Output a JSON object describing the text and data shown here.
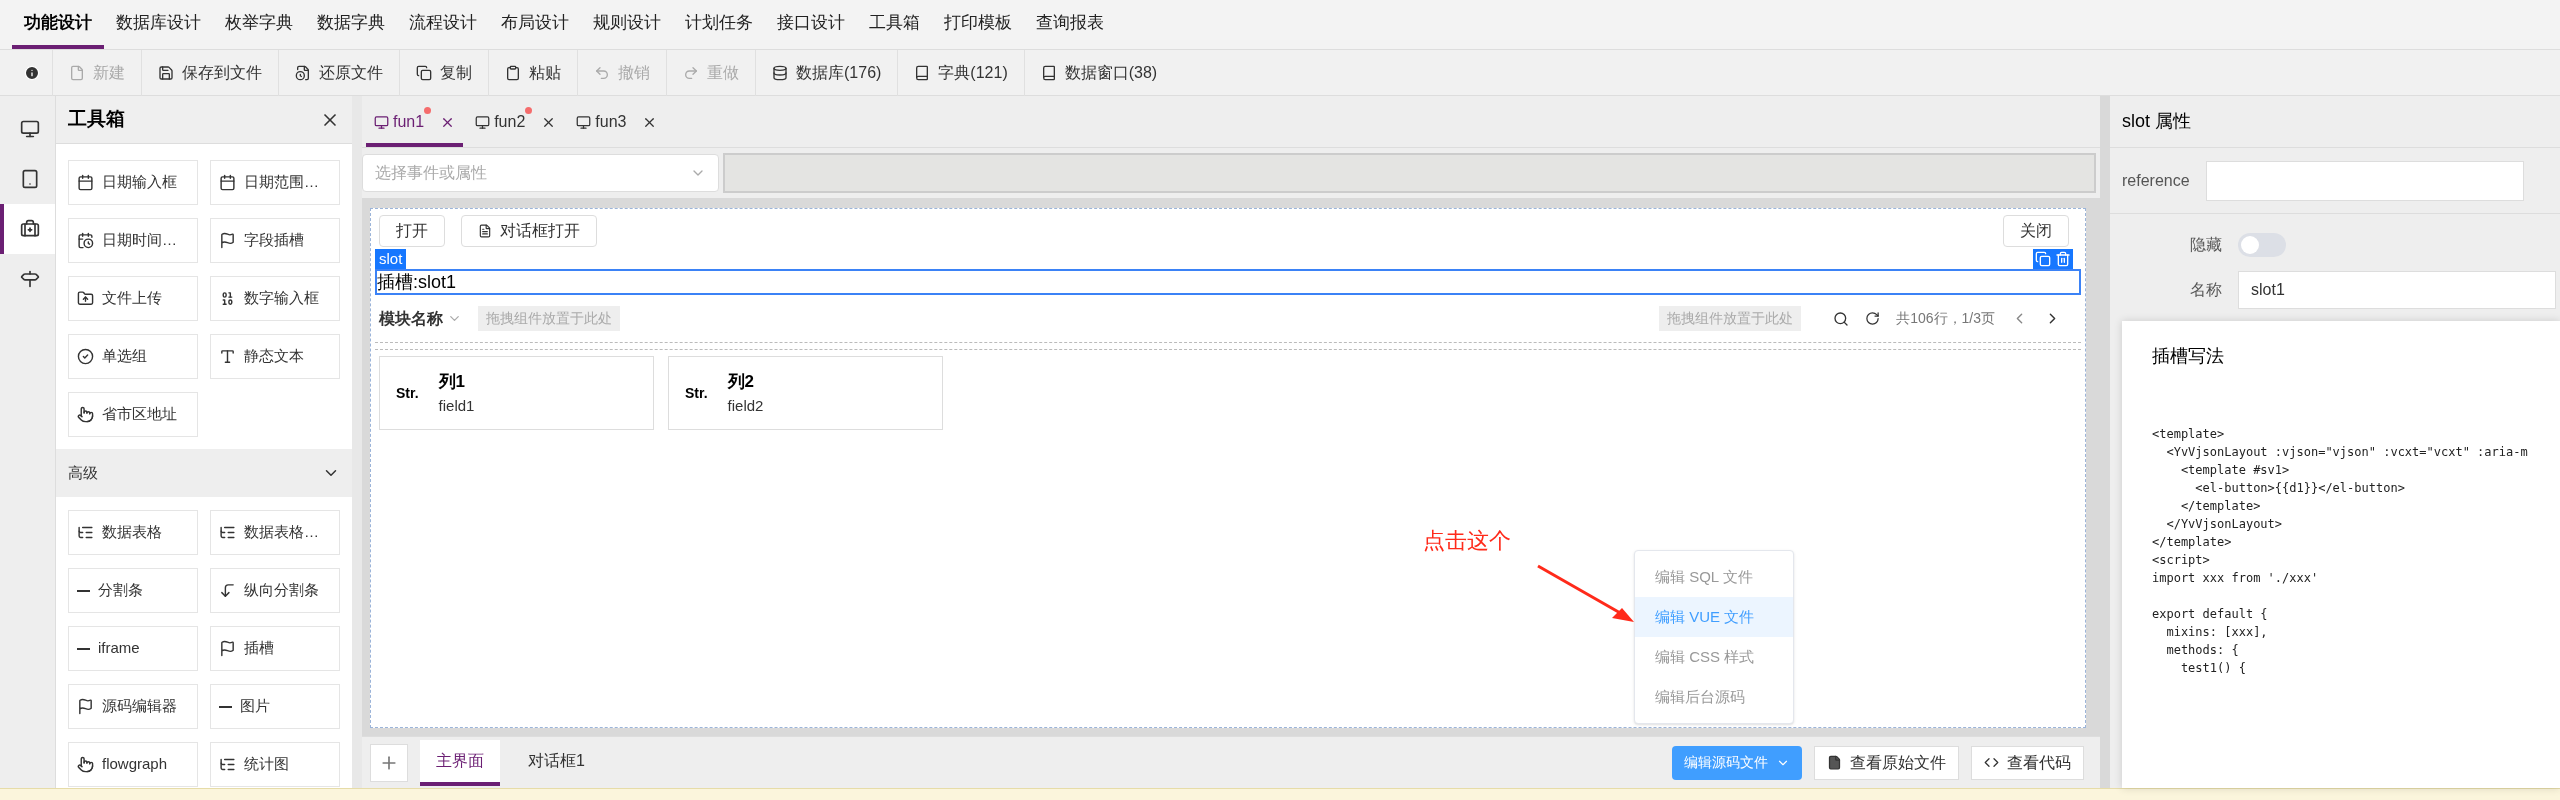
{
  "menu": [
    {
      "label": "功能设计",
      "selected": true
    },
    {
      "label": "数据库设计",
      "selected": false
    },
    {
      "label": "枚举字典",
      "selected": false
    },
    {
      "label": "数据字典",
      "selected": false
    },
    {
      "label": "流程设计",
      "selected": false
    },
    {
      "label": "布局设计",
      "selected": false
    },
    {
      "label": "规则设计",
      "selected": false
    },
    {
      "label": "计划任务",
      "selected": false
    },
    {
      "label": "接口设计",
      "selected": false
    },
    {
      "label": "工具箱",
      "selected": false
    },
    {
      "label": "打印模板",
      "selected": false
    },
    {
      "label": "查询报表",
      "selected": false
    }
  ],
  "toolbar": [
    {
      "kind": "new",
      "label": "新建",
      "disabled": true
    },
    {
      "kind": "save",
      "label": "保存到文件",
      "disabled": false
    },
    {
      "kind": "restore",
      "label": "还原文件",
      "disabled": false
    },
    {
      "kind": "copy",
      "label": "复制",
      "disabled": false
    },
    {
      "kind": "paste",
      "label": "粘贴",
      "disabled": false
    },
    {
      "kind": "undo",
      "label": "撤销",
      "disabled": true
    },
    {
      "kind": "redo",
      "label": "重做",
      "disabled": true
    },
    {
      "kind": "database",
      "label": "数据库(176)",
      "disabled": false
    },
    {
      "kind": "book",
      "label": "字典(121)",
      "disabled": false
    },
    {
      "kind": "book",
      "label": "数据窗口(38)",
      "disabled": false
    }
  ],
  "rail": [
    {
      "kind": "monitor",
      "selected": false
    },
    {
      "kind": "tablet",
      "selected": false
    },
    {
      "kind": "toolbox",
      "selected": true
    },
    {
      "kind": "signpost",
      "selected": false
    }
  ],
  "toolbox": {
    "title": "工具箱",
    "basic": [
      {
        "kind": "calendar",
        "label": "日期输入框"
      },
      {
        "kind": "calendar",
        "label": "日期范围…"
      },
      {
        "kind": "calendar-clock",
        "label": "日期时间…"
      },
      {
        "kind": "flag",
        "label": "字段插槽"
      },
      {
        "kind": "upload",
        "label": "文件上传"
      },
      {
        "kind": "number",
        "label": "数字输入框"
      },
      {
        "kind": "radio",
        "label": "单选组"
      },
      {
        "kind": "text",
        "label": "静态文本"
      },
      {
        "kind": "pointer",
        "label": "省市区地址"
      }
    ],
    "section": {
      "title": "高级",
      "expanded": true
    },
    "advanced": [
      {
        "kind": "table",
        "label": "数据表格"
      },
      {
        "kind": "table",
        "label": "数据表格…"
      },
      {
        "kind": "line",
        "label": "分割条"
      },
      {
        "kind": "vline",
        "label": "纵向分割条"
      },
      {
        "kind": "line",
        "label": "iframe"
      },
      {
        "kind": "flag",
        "label": "插槽"
      },
      {
        "kind": "flag",
        "label": "源码编辑器"
      },
      {
        "kind": "line",
        "label": "图片"
      },
      {
        "kind": "pointer",
        "label": "flowgraph"
      },
      {
        "kind": "table",
        "label": "统计图"
      }
    ]
  },
  "file_tabs": [
    {
      "label": "fun1",
      "modified": true,
      "selected": true
    },
    {
      "label": "fun2",
      "modified": true,
      "selected": false
    },
    {
      "label": "fun3",
      "modified": false,
      "selected": false
    }
  ],
  "event_select": {
    "placeholder": "选择事件或属性"
  },
  "canvas": {
    "buttons": [
      {
        "label": "打开",
        "kind": "plain"
      },
      {
        "label": "对话框打开",
        "kind": "file"
      }
    ],
    "close_button": "关闭",
    "slot": {
      "badge": "slot",
      "text": "插槽:slot1"
    },
    "module": {
      "title": "模块名称",
      "drop_left": "拖拽组件放置于此处",
      "drop_right": "拖拽组件放置于此处",
      "pager": "共106行，1/3页"
    },
    "cards": [
      {
        "type": "Str.",
        "title": "列1",
        "field": "field1"
      },
      {
        "type": "Str.",
        "title": "列2",
        "field": "field2"
      }
    ],
    "annotation": "点击这个"
  },
  "dropdown": [
    {
      "label": "编辑 SQL 文件",
      "selected": false
    },
    {
      "label": "编辑 VUE 文件",
      "selected": true
    },
    {
      "label": "编辑 CSS 样式",
      "selected": false
    },
    {
      "label": "编辑后台源码",
      "selected": false
    }
  ],
  "bottom_tabs": [
    {
      "label": "主界面",
      "selected": true
    },
    {
      "label": "对话框1",
      "selected": false
    }
  ],
  "bottom_buttons": {
    "source": "编辑源码文件",
    "original": "查看原始文件",
    "code": "查看代码"
  },
  "properties": {
    "title": "slot 属性",
    "reference_label": "reference",
    "hidden_label": "隐藏",
    "hidden": false,
    "name_label": "名称",
    "name_value": "slot1"
  },
  "slot_help": {
    "title": "插槽写法",
    "code_blocks": [
      [
        "<template>",
        "  <YvVjsonLayout :vjson=\"vjson\" :vcxt=\"vcxt\" :aria-m",
        "    <template #sv1>",
        "      <el-button>{{d1}}</el-button>",
        "    </template>",
        "  </YvVjsonLayout>",
        "</template>",
        "<script>",
        "import xxx from './xxx'"
      ],
      [
        "export default {",
        "  mixins: [xxx],",
        "  methods: {",
        "    test1() {"
      ]
    ]
  }
}
